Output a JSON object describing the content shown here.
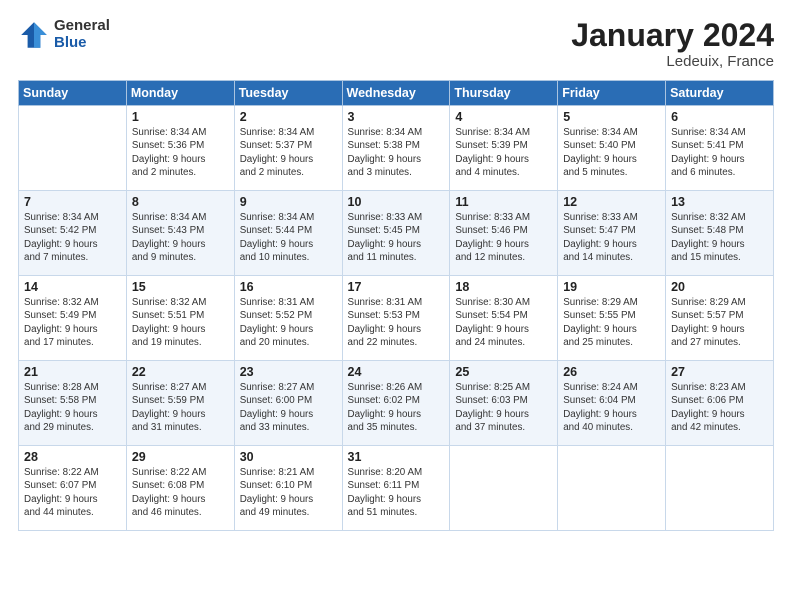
{
  "header": {
    "logo_general": "General",
    "logo_blue": "Blue",
    "month_title": "January 2024",
    "location": "Ledeuix, France"
  },
  "days_of_week": [
    "Sunday",
    "Monday",
    "Tuesday",
    "Wednesday",
    "Thursday",
    "Friday",
    "Saturday"
  ],
  "weeks": [
    [
      {
        "num": "",
        "info": ""
      },
      {
        "num": "1",
        "info": "Sunrise: 8:34 AM\nSunset: 5:36 PM\nDaylight: 9 hours\nand 2 minutes."
      },
      {
        "num": "2",
        "info": "Sunrise: 8:34 AM\nSunset: 5:37 PM\nDaylight: 9 hours\nand 2 minutes."
      },
      {
        "num": "3",
        "info": "Sunrise: 8:34 AM\nSunset: 5:38 PM\nDaylight: 9 hours\nand 3 minutes."
      },
      {
        "num": "4",
        "info": "Sunrise: 8:34 AM\nSunset: 5:39 PM\nDaylight: 9 hours\nand 4 minutes."
      },
      {
        "num": "5",
        "info": "Sunrise: 8:34 AM\nSunset: 5:40 PM\nDaylight: 9 hours\nand 5 minutes."
      },
      {
        "num": "6",
        "info": "Sunrise: 8:34 AM\nSunset: 5:41 PM\nDaylight: 9 hours\nand 6 minutes."
      }
    ],
    [
      {
        "num": "7",
        "info": "Sunrise: 8:34 AM\nSunset: 5:42 PM\nDaylight: 9 hours\nand 7 minutes."
      },
      {
        "num": "8",
        "info": "Sunrise: 8:34 AM\nSunset: 5:43 PM\nDaylight: 9 hours\nand 9 minutes."
      },
      {
        "num": "9",
        "info": "Sunrise: 8:34 AM\nSunset: 5:44 PM\nDaylight: 9 hours\nand 10 minutes."
      },
      {
        "num": "10",
        "info": "Sunrise: 8:33 AM\nSunset: 5:45 PM\nDaylight: 9 hours\nand 11 minutes."
      },
      {
        "num": "11",
        "info": "Sunrise: 8:33 AM\nSunset: 5:46 PM\nDaylight: 9 hours\nand 12 minutes."
      },
      {
        "num": "12",
        "info": "Sunrise: 8:33 AM\nSunset: 5:47 PM\nDaylight: 9 hours\nand 14 minutes."
      },
      {
        "num": "13",
        "info": "Sunrise: 8:32 AM\nSunset: 5:48 PM\nDaylight: 9 hours\nand 15 minutes."
      }
    ],
    [
      {
        "num": "14",
        "info": "Sunrise: 8:32 AM\nSunset: 5:49 PM\nDaylight: 9 hours\nand 17 minutes."
      },
      {
        "num": "15",
        "info": "Sunrise: 8:32 AM\nSunset: 5:51 PM\nDaylight: 9 hours\nand 19 minutes."
      },
      {
        "num": "16",
        "info": "Sunrise: 8:31 AM\nSunset: 5:52 PM\nDaylight: 9 hours\nand 20 minutes."
      },
      {
        "num": "17",
        "info": "Sunrise: 8:31 AM\nSunset: 5:53 PM\nDaylight: 9 hours\nand 22 minutes."
      },
      {
        "num": "18",
        "info": "Sunrise: 8:30 AM\nSunset: 5:54 PM\nDaylight: 9 hours\nand 24 minutes."
      },
      {
        "num": "19",
        "info": "Sunrise: 8:29 AM\nSunset: 5:55 PM\nDaylight: 9 hours\nand 25 minutes."
      },
      {
        "num": "20",
        "info": "Sunrise: 8:29 AM\nSunset: 5:57 PM\nDaylight: 9 hours\nand 27 minutes."
      }
    ],
    [
      {
        "num": "21",
        "info": "Sunrise: 8:28 AM\nSunset: 5:58 PM\nDaylight: 9 hours\nand 29 minutes."
      },
      {
        "num": "22",
        "info": "Sunrise: 8:27 AM\nSunset: 5:59 PM\nDaylight: 9 hours\nand 31 minutes."
      },
      {
        "num": "23",
        "info": "Sunrise: 8:27 AM\nSunset: 6:00 PM\nDaylight: 9 hours\nand 33 minutes."
      },
      {
        "num": "24",
        "info": "Sunrise: 8:26 AM\nSunset: 6:02 PM\nDaylight: 9 hours\nand 35 minutes."
      },
      {
        "num": "25",
        "info": "Sunrise: 8:25 AM\nSunset: 6:03 PM\nDaylight: 9 hours\nand 37 minutes."
      },
      {
        "num": "26",
        "info": "Sunrise: 8:24 AM\nSunset: 6:04 PM\nDaylight: 9 hours\nand 40 minutes."
      },
      {
        "num": "27",
        "info": "Sunrise: 8:23 AM\nSunset: 6:06 PM\nDaylight: 9 hours\nand 42 minutes."
      }
    ],
    [
      {
        "num": "28",
        "info": "Sunrise: 8:22 AM\nSunset: 6:07 PM\nDaylight: 9 hours\nand 44 minutes."
      },
      {
        "num": "29",
        "info": "Sunrise: 8:22 AM\nSunset: 6:08 PM\nDaylight: 9 hours\nand 46 minutes."
      },
      {
        "num": "30",
        "info": "Sunrise: 8:21 AM\nSunset: 6:10 PM\nDaylight: 9 hours\nand 49 minutes."
      },
      {
        "num": "31",
        "info": "Sunrise: 8:20 AM\nSunset: 6:11 PM\nDaylight: 9 hours\nand 51 minutes."
      },
      {
        "num": "",
        "info": ""
      },
      {
        "num": "",
        "info": ""
      },
      {
        "num": "",
        "info": ""
      }
    ]
  ]
}
